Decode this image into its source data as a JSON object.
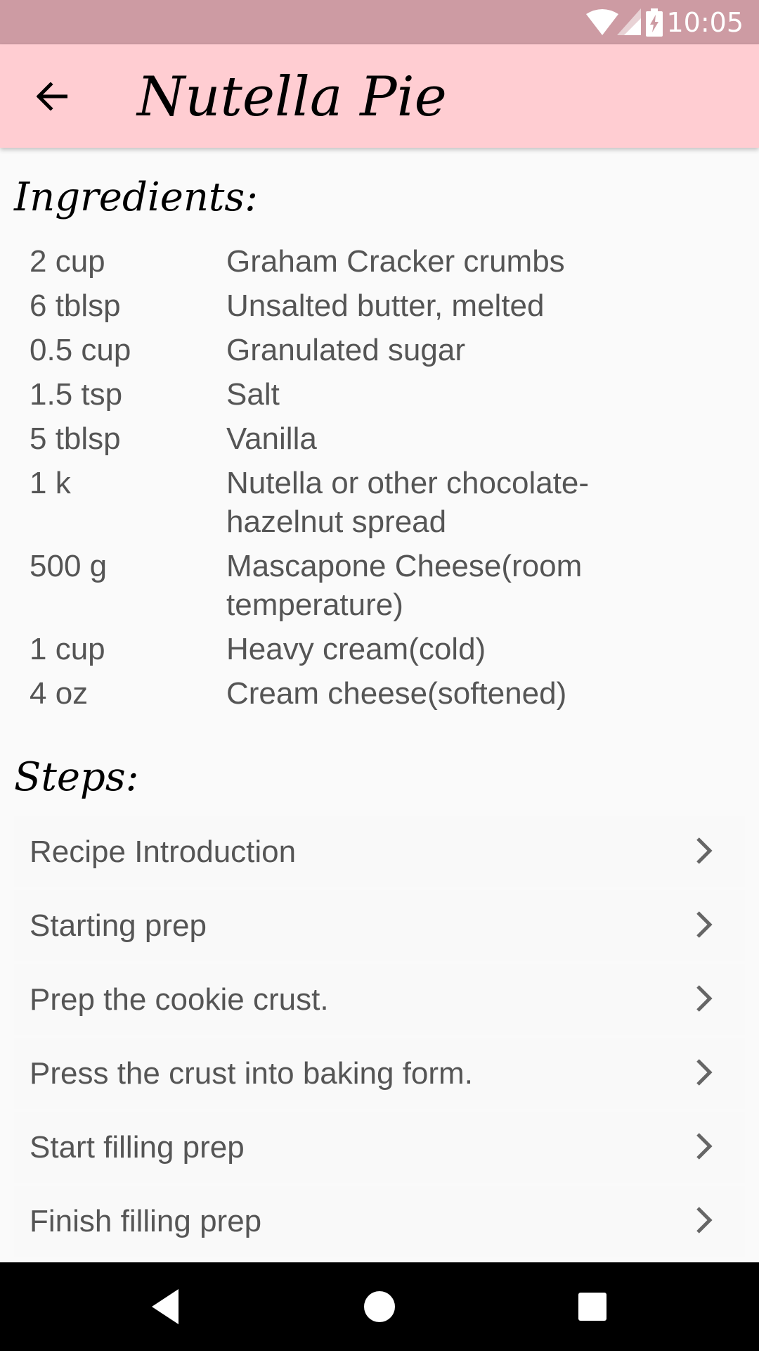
{
  "status_bar": {
    "time": "10:05",
    "icons": [
      "wifi-icon",
      "signal-icon",
      "battery-charging-icon"
    ]
  },
  "app_bar": {
    "title": "Nutella Pie",
    "back_icon": "arrow-back-icon"
  },
  "ingredients": {
    "heading": "Ingredients:",
    "items": [
      {
        "qty": "2 cup",
        "name": "Graham Cracker crumbs"
      },
      {
        "qty": "6 tblsp",
        "name": "Unsalted butter, melted"
      },
      {
        "qty": "0.5 cup",
        "name": "Granulated sugar"
      },
      {
        "qty": "1.5 tsp",
        "name": "Salt"
      },
      {
        "qty": "5 tblsp",
        "name": "Vanilla"
      },
      {
        "qty": "1 k",
        "name": "Nutella or other chocolate-hazelnut spread"
      },
      {
        "qty": "500 g",
        "name": "Mascapone Cheese(room temperature)"
      },
      {
        "qty": "1 cup",
        "name": "Heavy cream(cold)"
      },
      {
        "qty": "4 oz",
        "name": "Cream cheese(softened)"
      }
    ]
  },
  "steps": {
    "heading": "Steps:",
    "items": [
      {
        "label": "Recipe Introduction"
      },
      {
        "label": "Starting prep"
      },
      {
        "label": "Prep the cookie crust."
      },
      {
        "label": "Press the crust into baking form."
      },
      {
        "label": "Start filling prep"
      },
      {
        "label": "Finish filling prep"
      }
    ]
  },
  "nav_bar": {
    "icons": [
      "nav-back-icon",
      "nav-home-icon",
      "nav-recents-icon"
    ]
  },
  "colors": {
    "status_bar": "#cd9ba3",
    "app_bar": "#ffcdd2",
    "background": "#fafafa",
    "text": "#555555"
  }
}
